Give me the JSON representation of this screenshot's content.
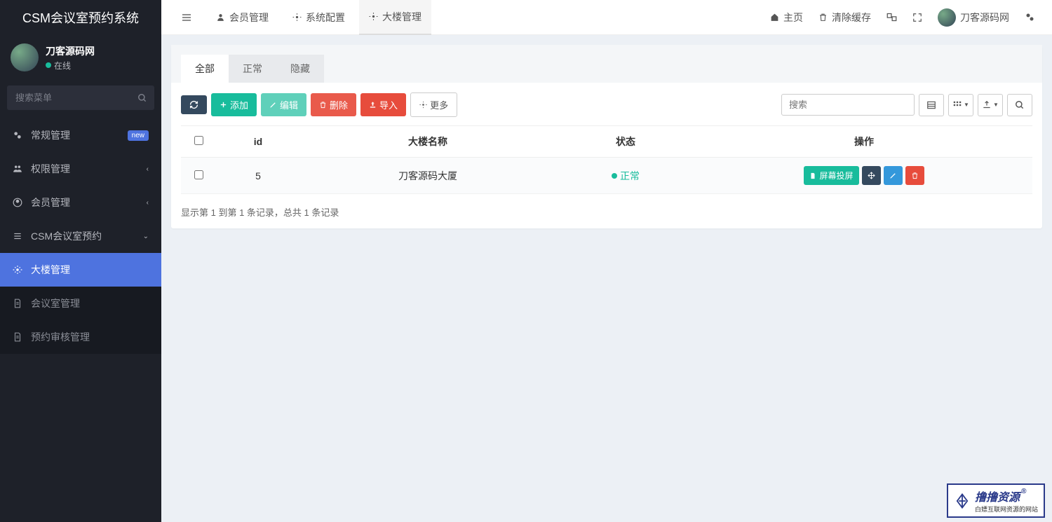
{
  "app": {
    "title": "CSM会议室预约系统"
  },
  "user": {
    "name": "刀客源码网",
    "status": "在线"
  },
  "sidebar": {
    "search_placeholder": "搜索菜单",
    "items": [
      {
        "label": "常规管理",
        "badge": "new"
      },
      {
        "label": "权限管理"
      },
      {
        "label": "会员管理"
      },
      {
        "label": "CSM会议室预约"
      }
    ],
    "submenu": [
      {
        "label": "大楼管理"
      },
      {
        "label": "会议室管理"
      },
      {
        "label": "预约审核管理"
      }
    ]
  },
  "topbar": {
    "tabs": [
      {
        "label": "会员管理"
      },
      {
        "label": "系统配置"
      },
      {
        "label": "大楼管理"
      }
    ],
    "home": "主页",
    "clear_cache": "清除缓存",
    "username": "刀客源码网"
  },
  "tabs": {
    "all": "全部",
    "normal": "正常",
    "hidden": "隐藏"
  },
  "toolbar": {
    "add": "添加",
    "edit": "编辑",
    "delete": "删除",
    "import": "导入",
    "more": "更多",
    "search_placeholder": "搜索"
  },
  "table": {
    "headers": {
      "id": "id",
      "name": "大楼名称",
      "status": "状态",
      "action": "操作"
    },
    "rows": [
      {
        "id": "5",
        "name": "刀客源码大厦",
        "status": "正常",
        "action_label": "屏幕投屏"
      }
    ],
    "info": "显示第 1 到第 1 条记录，总共 1 条记录"
  },
  "footer": {
    "main": "撸撸资源",
    "sub": "白嫖互联网资源的网站"
  }
}
